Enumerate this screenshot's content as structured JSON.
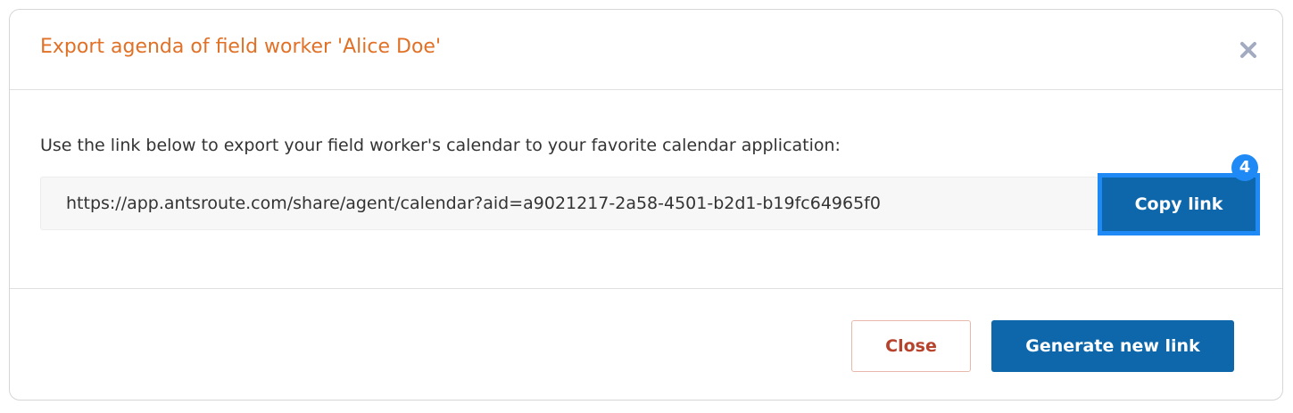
{
  "dialog": {
    "title": "Export agenda of field worker 'Alice Doe'",
    "close_icon": "close-x-icon"
  },
  "body": {
    "instructions": "Use the link below to export your field worker's calendar to your favorite calendar application:",
    "link_value": "https://app.antsroute.com/share/agent/calendar?aid=a9021217-2a58-4501-b2d1-b19fc64965f0",
    "copy_label": "Copy link",
    "step_badge": "4"
  },
  "footer": {
    "close_label": "Close",
    "generate_label": "Generate new link"
  },
  "colors": {
    "title": "#e07126",
    "primary": "#0d67aa",
    "highlight": "#1f8af5",
    "close_text": "#b8432d"
  }
}
